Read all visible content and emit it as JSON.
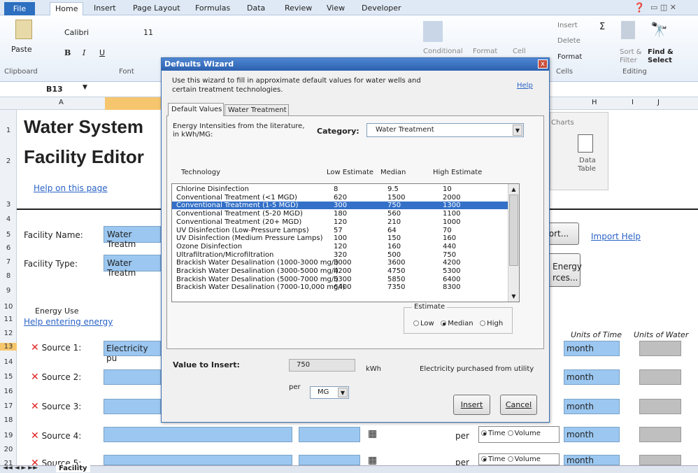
{
  "ribbon": {
    "tabs": [
      "Home",
      "Insert",
      "Page Layout",
      "Formulas",
      "Data",
      "Review",
      "View",
      "Developer"
    ],
    "file_tab": "File",
    "paste": "Paste",
    "font_name": "Calibri",
    "font_size": "11",
    "clipboard": "Clipboard",
    "font_group": "Font",
    "conditional": "Conditional",
    "format_as": "Format",
    "cell_styles": "Cell",
    "insert": "Insert",
    "delete": "Delete",
    "format": "Format",
    "cells": "Cells",
    "sort_filter": "Sort &",
    "filter": "Filter",
    "find_select": "Find &",
    "select": "Select",
    "editing": "Editing",
    "charts": "Charts",
    "data_table_1": "Data",
    "data_table_2": "Table"
  },
  "formula_bar": {
    "name_box": "B13"
  },
  "columns": [
    "A",
    "H",
    "I",
    "J"
  ],
  "rows": [
    "1",
    "2",
    "3",
    "4",
    "5",
    "6",
    "7",
    "8",
    "9",
    "10",
    "11",
    "12",
    "13",
    "14",
    "15",
    "16",
    "17",
    "18",
    "19",
    "20",
    "21"
  ],
  "sheet": {
    "title_line1": "Water System",
    "title_line2": "Facility Editor",
    "help_page": "Help on this page",
    "facility_name_label": "Facility Name:",
    "facility_name_value": "Water Treatm",
    "facility_type_label": "Facility Type:",
    "facility_type_value": "Water Treatm",
    "import_btn": "ort...",
    "import_help": "Import Help",
    "energy_btn_1": "Energy",
    "energy_btn_2": "rces...",
    "energy_use": "Energy Use",
    "help_energy": "Help entering energy",
    "units_time": "Units of Time",
    "units_water": "Units of Water",
    "sources": [
      "Source 1:",
      "Source 2:",
      "Source 3:",
      "Source 4:",
      "Source 5:"
    ],
    "source1_value": "Electricity pu",
    "month": "month",
    "per": "per",
    "time": "Time",
    "volume": "Volume",
    "sheet_tab": "Facility"
  },
  "dialog": {
    "title": "Defaults Wizard",
    "close": "x",
    "intro": "Use this wizard to fill in approximate default values for water wells and certain treatment technologies.",
    "help": "Help",
    "tabs": [
      "Default Values",
      "Water Treatment"
    ],
    "energy_label": "Energy Intensities from the literature, in kWh/MG:",
    "category_label": "Category:",
    "category_value": "Water Treatment",
    "col_technology": "Technology",
    "col_low": "Low Estimate",
    "col_median": "Median",
    "col_high": "High Estimate",
    "rows": [
      {
        "tech": "Chlorine Disinfection",
        "low": "8",
        "med": "9.5",
        "high": "10"
      },
      {
        "tech": "Conventional Treatment (<1 MGD)",
        "low": "620",
        "med": "1500",
        "high": "2000"
      },
      {
        "tech": "Conventional Treatment (1-5 MGD)",
        "low": "300",
        "med": "750",
        "high": "1300"
      },
      {
        "tech": "Conventional Treatment (5-20 MGD)",
        "low": "180",
        "med": "560",
        "high": "1100"
      },
      {
        "tech": "Conventional Treatment (20+ MGD)",
        "low": "120",
        "med": "210",
        "high": "1000"
      },
      {
        "tech": "UV Disinfection (Low-Pressure Lamps)",
        "low": "57",
        "med": "64",
        "high": "70"
      },
      {
        "tech": "UV Disinfection (Medium Pressure Lamps)",
        "low": "100",
        "med": "150",
        "high": "160"
      },
      {
        "tech": "Ozone Disinfection",
        "low": "120",
        "med": "160",
        "high": "440"
      },
      {
        "tech": "Ultrafiltration/Microfiltration",
        "low": "320",
        "med": "500",
        "high": "750"
      },
      {
        "tech": "Brackish Water Desalination (1000-3000 mg/l)",
        "low": "3000",
        "med": "3600",
        "high": "4200"
      },
      {
        "tech": "Brackish Water Desalination (3000-5000 mg/l)",
        "low": "4200",
        "med": "4750",
        "high": "5300"
      },
      {
        "tech": "Brackish Water Desalination (5000-7000 mg/l)",
        "low": "5300",
        "med": "5850",
        "high": "6400"
      },
      {
        "tech": "Brackish Water Desalination (7000-10,000 mg/l)",
        "low": "6400",
        "med": "7350",
        "high": "8300"
      }
    ],
    "selected_index": 2,
    "estimate_label": "Estimate",
    "estimate_low": "Low",
    "estimate_median": "Median",
    "estimate_high": "High",
    "value_label": "Value to Insert:",
    "value": "750",
    "unit": "kWh",
    "source_desc": "Electricity purchased from utility",
    "per": "per",
    "per_value": "MG",
    "insert_btn": "Insert",
    "cancel_btn": "Cancel"
  }
}
